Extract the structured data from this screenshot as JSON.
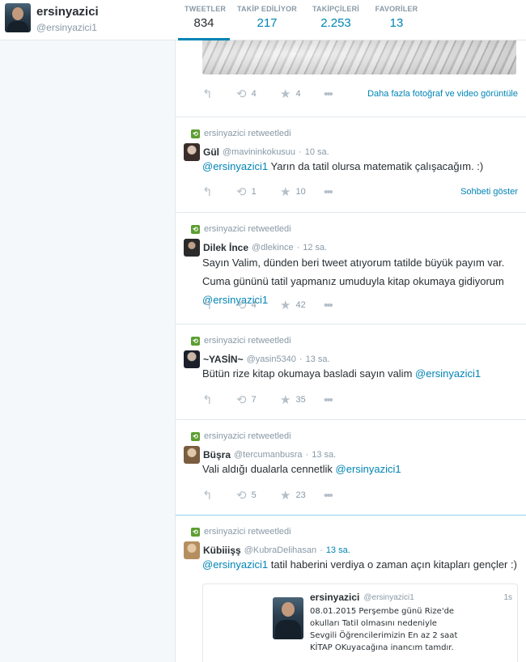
{
  "profile": {
    "name": "ersinyazici",
    "handle": "@ersinyazici1"
  },
  "stats": [
    {
      "label": "TWEETLER",
      "value": "834"
    },
    {
      "label": "TAKİP EDİLİYOR",
      "value": "217"
    },
    {
      "label": "TAKİPÇİLERİ",
      "value": "2.253"
    },
    {
      "label": "FAVORİLER",
      "value": "13"
    }
  ],
  "top_actions": {
    "retweets": "4",
    "favorites": "4",
    "link": "Daha fazla fotoğraf ve video görüntüle"
  },
  "tweets": [
    {
      "rt_label": "ersinyazici retweetledi",
      "author": "Gül",
      "handle": "@mavininkokusuu",
      "time": "10 sa.",
      "mention": "@ersinyazici1",
      "text": " Yarın da tatil olursa matematik çalışacağım. :)",
      "retweets": "1",
      "favorites": "10",
      "link": "Sohbeti göster"
    },
    {
      "rt_label": "ersinyazici retweetledi",
      "author": "Dilek İnce",
      "handle": "@dlekince",
      "time": "12 sa.",
      "text": "Sayın Valim, dünden beri tweet atıyorum tatilde büyük payım var. Cuma gününü tatil yapmanız umuduyla kitap okumaya gidiyorum ",
      "mention": "@ersinyazici1",
      "retweets": "4",
      "favorites": "42"
    },
    {
      "rt_label": "ersinyazici retweetledi",
      "author": "~YASİN~",
      "handle": "@yasin5340",
      "time": "13 sa.",
      "text": "Bütün rize kitap okumaya basladi sayın valim ",
      "mention": "@ersinyazici1",
      "retweets": "7",
      "favorites": "35"
    },
    {
      "rt_label": "ersinyazici retweetledi",
      "author": "Büşra",
      "handle": "@tercumanbusra",
      "time": "13 sa.",
      "text": "Vali aldığı dualarla cennetlik ",
      "mention": "@ersinyazici1",
      "retweets": "5",
      "favorites": "23"
    },
    {
      "rt_label": "ersinyazici retweetledi",
      "author": "Kübiiişş",
      "handle": "@KubraDelihasan",
      "time": "13 sa.",
      "mention": "@ersinyazici1",
      "text": " tatil haberini verdiya o zaman açın kitapları gençler :)",
      "quote": {
        "name": "ersinyazici",
        "handle": "@ersinyazici1",
        "time": "1s",
        "text": "08.01.2015 Perşembe günü Rize'de okulları Tatil olmasını nedeniyle Sevgili Öğrencilerimizin En az 2 saat KİTAP OKuyacağına inancım tamdır."
      }
    }
  ],
  "icons": {
    "reply": "reply-icon",
    "retweet": "retweet-icon",
    "favorite": "star-icon",
    "more": "more-icon"
  },
  "colors": {
    "link": "#0084b4",
    "retweet_badge": "#5c9e31",
    "text": "#292f33",
    "muted": "#8899a6"
  }
}
